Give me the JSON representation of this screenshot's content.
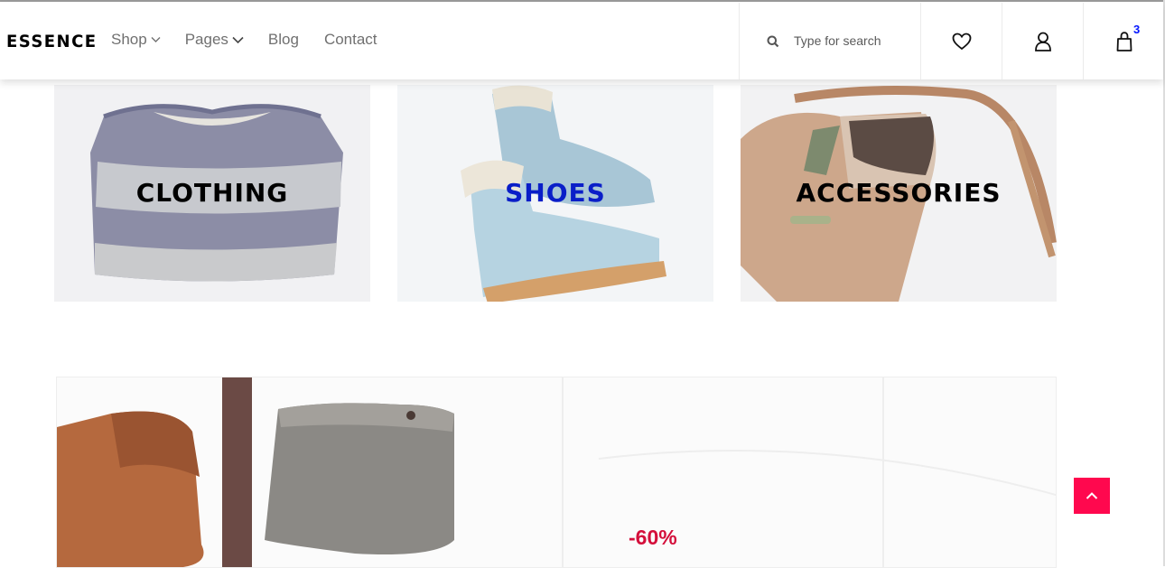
{
  "brand": {
    "logo": "ESSENCE"
  },
  "nav": {
    "items": [
      {
        "label": "Shop",
        "has_dropdown": true
      },
      {
        "label": "Pages",
        "has_dropdown": true
      },
      {
        "label": "Blog",
        "has_dropdown": false
      },
      {
        "label": "Contact",
        "has_dropdown": false
      }
    ]
  },
  "search": {
    "placeholder": "Type for search",
    "icon": "search-icon"
  },
  "header_icons": {
    "wishlist_icon": "heart-icon",
    "user_icon": "user-icon",
    "cart_icon": "shopping-bag-icon",
    "cart_count": "3"
  },
  "categories": [
    {
      "label": "CLOTHING"
    },
    {
      "label": "SHOES"
    },
    {
      "label": "ACCESSORIES"
    }
  ],
  "banner": {
    "discount": "-60%"
  },
  "colors": {
    "accent": "#ff084e",
    "cart_badge": "#0315ff",
    "discount": "#d40f3b",
    "active_category": "#0a1ec8"
  },
  "back_to_top": {
    "icon": "chevron-up-icon"
  }
}
